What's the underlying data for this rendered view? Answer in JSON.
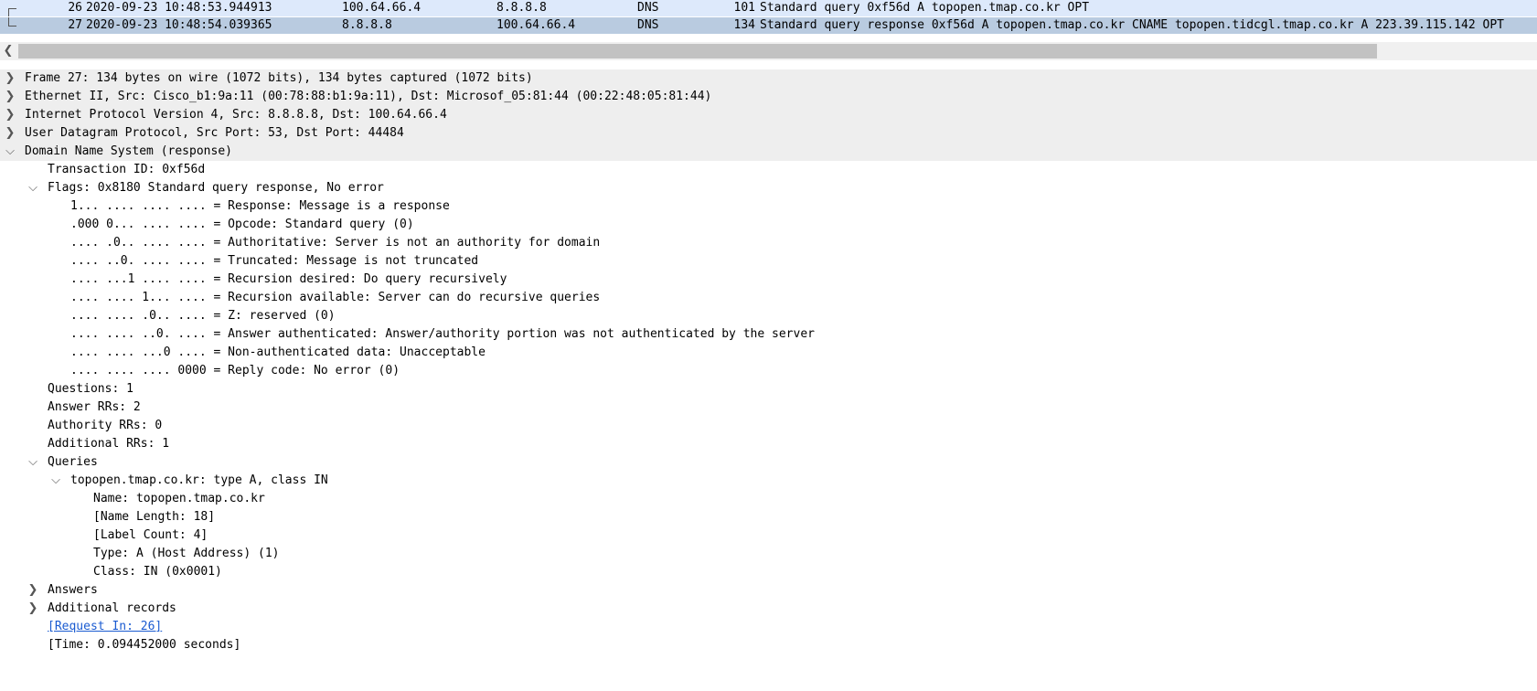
{
  "packet_list": {
    "rows": [
      {
        "no": "26",
        "time": "2020-09-23 10:48:53.944913",
        "source": "100.64.66.4",
        "destination": "8.8.8.8",
        "protocol": "DNS",
        "length": "101",
        "info": "Standard query 0xf56d A topopen.tmap.co.kr OPT"
      },
      {
        "no": "27",
        "time": "2020-09-23 10:48:54.039365",
        "source": "8.8.8.8",
        "destination": "100.64.66.4",
        "protocol": "DNS",
        "length": "134",
        "info": "Standard query response 0xf56d A topopen.tmap.co.kr CNAME topopen.tidcgl.tmap.co.kr A 223.39.115.142 OPT"
      }
    ]
  },
  "scrollbar": {
    "left_arrow_icon": "chevron-left-icon"
  },
  "detail_tree": {
    "frame": "Frame 27: 134 bytes on wire (1072 bits), 134 bytes captured (1072 bits)",
    "ethernet": "Ethernet II, Src: Cisco_b1:9a:11 (00:78:88:b1:9a:11), Dst: Microsof_05:81:44 (00:22:48:05:81:44)",
    "ipv4": "Internet Protocol Version 4, Src: 8.8.8.8, Dst: 100.64.66.4",
    "udp": "User Datagram Protocol, Src Port: 53, Dst Port: 44484",
    "dns": "Domain Name System (response)",
    "transaction_id": "Transaction ID: 0xf56d",
    "flags": "Flags: 0x8180 Standard query response, No error",
    "flag_bits": [
      "1... .... .... .... = Response: Message is a response",
      ".000 0... .... .... = Opcode: Standard query (0)",
      ".... .0.. .... .... = Authoritative: Server is not an authority for domain",
      ".... ..0. .... .... = Truncated: Message is not truncated",
      ".... ...1 .... .... = Recursion desired: Do query recursively",
      ".... .... 1... .... = Recursion available: Server can do recursive queries",
      ".... .... .0.. .... = Z: reserved (0)",
      ".... .... ..0. .... = Answer authenticated: Answer/authority portion was not authenticated by the server",
      ".... .... ...0 .... = Non-authenticated data: Unacceptable",
      ".... .... .... 0000 = Reply code: No error (0)"
    ],
    "questions": "Questions: 1",
    "answer_rrs": "Answer RRs: 2",
    "authority_rrs": "Authority RRs: 0",
    "additional_rrs": "Additional RRs: 1",
    "queries": "Queries",
    "query_entry": "topopen.tmap.co.kr: type A, class IN",
    "query_fields": [
      "Name: topopen.tmap.co.kr",
      "[Name Length: 18]",
      "[Label Count: 4]",
      "Type: A (Host Address) (1)",
      "Class: IN (0x0001)"
    ],
    "answers": "Answers",
    "additional_records": "Additional records",
    "request_in": "[Request In: 26]",
    "time": "[Time: 0.094452000 seconds]"
  }
}
